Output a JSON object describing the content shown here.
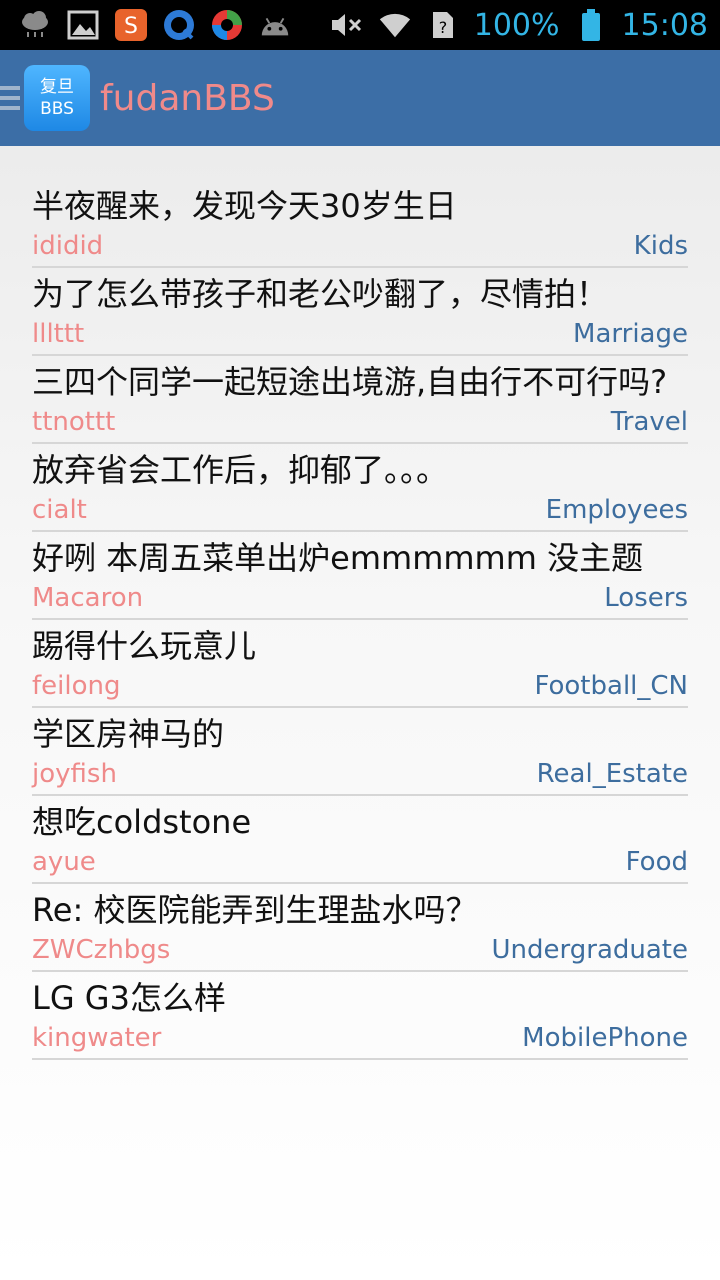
{
  "status_bar": {
    "left_icons": [
      "cloud-rain-icon",
      "image-icon",
      "sogou-icon",
      "qq-browser-icon",
      "color-ring-icon",
      "android-icon"
    ],
    "right_icons": [
      "mute-icon",
      "wifi-icon",
      "no-sim-icon"
    ],
    "battery_percent": "100%",
    "time": "15:08"
  },
  "app_bar": {
    "logo_line1": "复旦",
    "logo_line2": "BBS",
    "title": "fudanBBS"
  },
  "posts": [
    {
      "title": "半夜醒来，发现今天30岁生日",
      "author": "ididid",
      "board": "Kids"
    },
    {
      "title": "为了怎么带孩子和老公吵翻了，尽情拍！",
      "author": "lllttt",
      "board": "Marriage"
    },
    {
      "title": "三四个同学一起短途出境游,自由行不可行吗?",
      "author": "ttnottt",
      "board": "Travel"
    },
    {
      "title": "放弃省会工作后，抑郁了。。。",
      "author": "cialt",
      "board": "Employees"
    },
    {
      "title": "好咧 本周五菜单出炉emmmmmm 没主题",
      "author": "Macaron",
      "board": "Losers"
    },
    {
      "title": "踢得什么玩意儿",
      "author": "feilong",
      "board": "Football_CN"
    },
    {
      "title": "学区房神马的",
      "author": "joyfish",
      "board": "Real_Estate"
    },
    {
      "title": "想吃coldstone",
      "author": "ayue",
      "board": "Food"
    },
    {
      "title": "Re: 校医院能弄到生理盐水吗？",
      "author": "ZWCzhbgs",
      "board": "Undergraduate"
    },
    {
      "title": "LG G3怎么样",
      "author": "kingwater",
      "board": "MobilePhone"
    }
  ],
  "colors": {
    "app_bar": "#3c6ea6",
    "author": "#ef8a8a",
    "board": "#3d6d9e",
    "status_accent": "#33b5e5"
  }
}
